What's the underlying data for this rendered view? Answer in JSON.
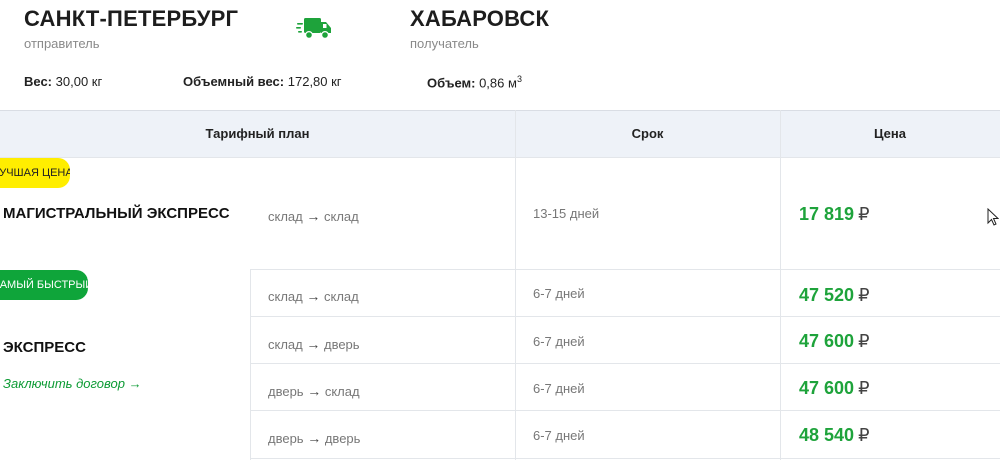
{
  "route": {
    "origin": {
      "city": "САНКТ-ПЕТЕРБУРГ",
      "role": "отправитель"
    },
    "destination": {
      "city": "ХАБАРОВСК",
      "role": "получатель"
    },
    "truck_icon": "delivery-truck-icon",
    "accent_color": "#1ea33b"
  },
  "metrics": {
    "weight_label": "Вес:",
    "weight_value": "30,00 кг",
    "volumetric_label": "Объемный вес:",
    "volumetric_value": "172,80 кг",
    "volume_label": "Объем:",
    "volume_value": "0,86 м",
    "volume_exp": "3"
  },
  "table": {
    "headers": {
      "plan": "Тарифный план",
      "term": "Срок",
      "price": "Цена"
    },
    "currency": "₽",
    "groups": [
      {
        "badge": "ЛУЧШАЯ ЦЕНА",
        "badge_color": "#ffee00",
        "name": "МАГИСТРАЛЬНЫЙ ЭКСПРЕСС",
        "rows": [
          {
            "from": "склад",
            "to": "склад",
            "term": "13-15 дней",
            "price": "17 819"
          }
        ]
      },
      {
        "badge": "САМЫЙ БЫСТРЫЙ",
        "badge_color": "#0fa53a",
        "name": "ЭКСПРЕСС",
        "contract_link": "Заключить договор →",
        "rows": [
          {
            "from": "склад",
            "to": "склад",
            "term": "6-7 дней",
            "price": "47 520"
          },
          {
            "from": "склад",
            "to": "дверь",
            "term": "6-7 дней",
            "price": "47 600"
          },
          {
            "from": "дверь",
            "to": "склад",
            "term": "6-7 дней",
            "price": "47 600"
          },
          {
            "from": "дверь",
            "to": "дверь",
            "term": "6-7 дней",
            "price": "48 540"
          }
        ]
      }
    ],
    "arrow": "→"
  }
}
